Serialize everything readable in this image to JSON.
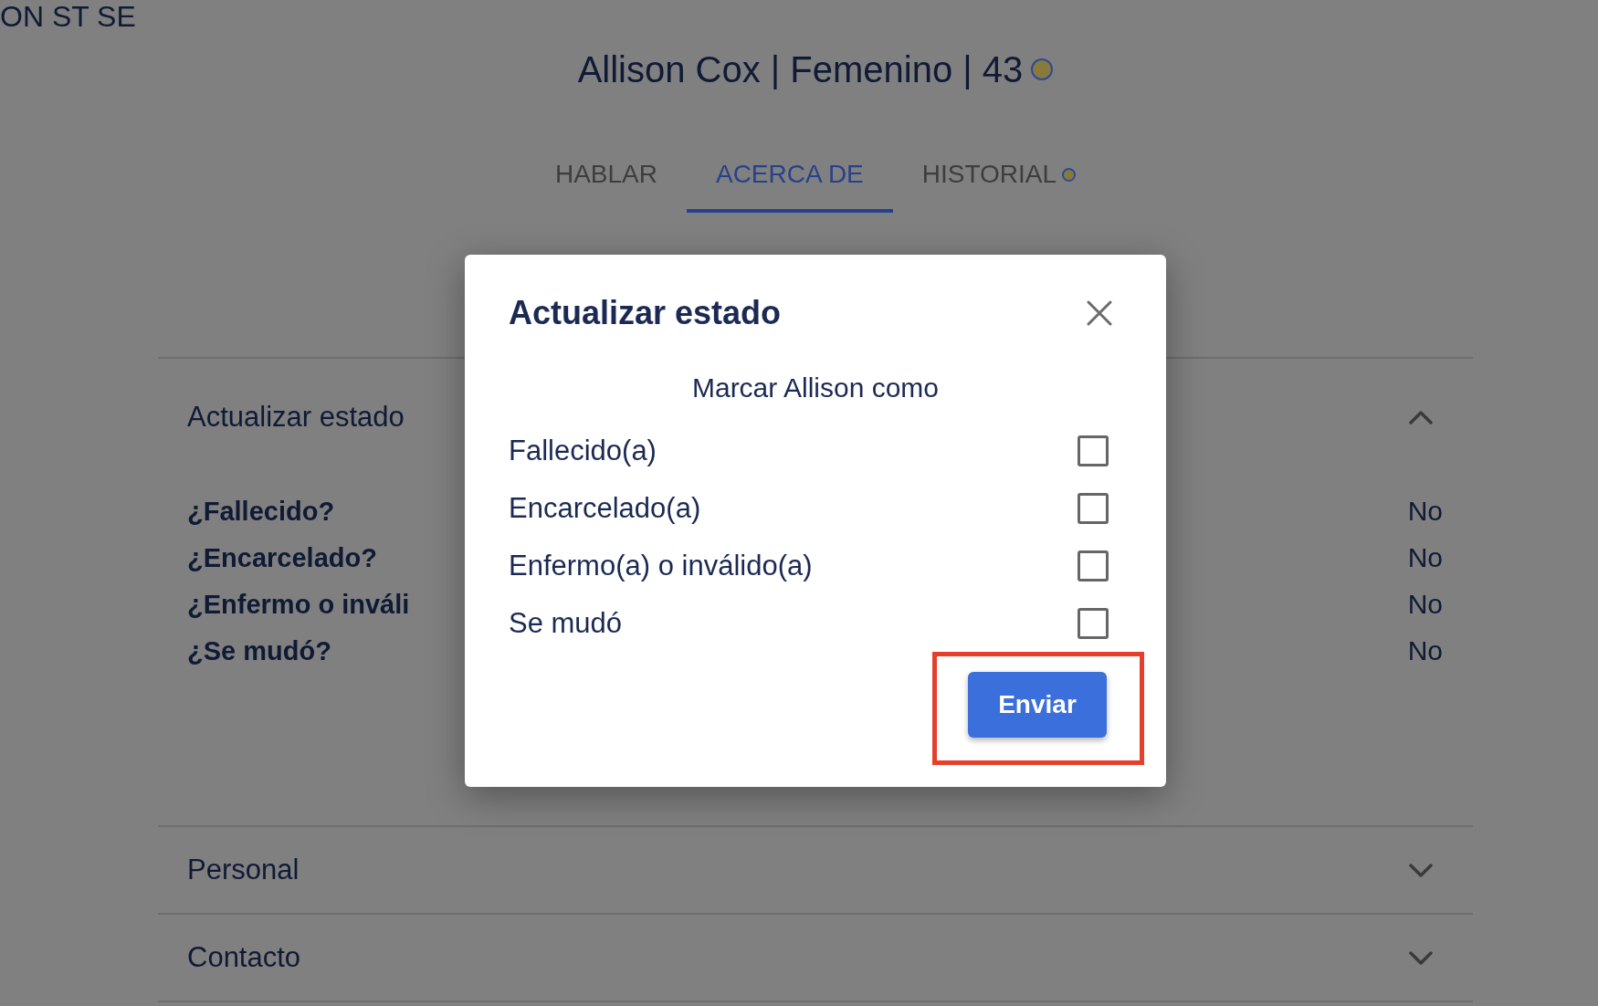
{
  "top_fragment": "ON ST SE",
  "header": {
    "title": "Allison Cox | Femenino | 43",
    "indicator": true
  },
  "tabs": [
    {
      "label": "HABLAR",
      "selected": false,
      "indicator": false
    },
    {
      "label": "ACERCA DE",
      "selected": true,
      "indicator": false
    },
    {
      "label": "HISTORIAL",
      "selected": false,
      "indicator": true
    }
  ],
  "sections": [
    {
      "title": "Actualizar estado",
      "expanded": true,
      "rows": [
        {
          "label": "¿Fallecido?",
          "value": "No"
        },
        {
          "label": "¿Encarcelado?",
          "value": "No"
        },
        {
          "label": "¿Enfermo o inváli",
          "value": "No"
        },
        {
          "label": "¿Se mudó?",
          "value": "No"
        }
      ]
    },
    {
      "title": "Personal",
      "expanded": false
    },
    {
      "title": "Contacto",
      "expanded": false
    }
  ],
  "dialog": {
    "title": "Actualizar estado",
    "prompt": "Marcar Allison como",
    "options": [
      {
        "label": "Fallecido(a)",
        "checked": false
      },
      {
        "label": "Encarcelado(a)",
        "checked": false
      },
      {
        "label": "Enfermo(a) o inválido(a)",
        "checked": false
      },
      {
        "label": "Se mudó",
        "checked": false
      }
    ],
    "submit": {
      "label": "Enviar",
      "highlighted": true
    }
  }
}
